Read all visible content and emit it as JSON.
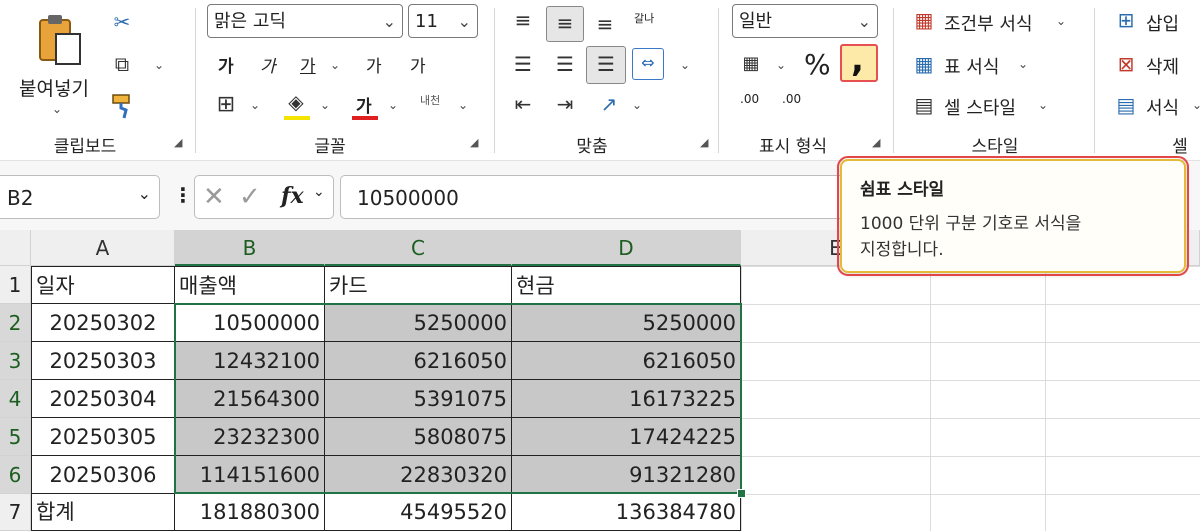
{
  "ribbon": {
    "clipboard": {
      "paste_label": "붙여넣기",
      "group_label": "클립보드"
    },
    "font": {
      "font_name": "맑은 고딕",
      "font_size": "11",
      "group_label": "글꼴",
      "bold": "가",
      "italic": "가",
      "underline": "가",
      "grow_font": "가",
      "shrink_font": "가",
      "font_color_glyph": "가",
      "phonetic_label": "내천"
    },
    "alignment": {
      "group_label": "맞춤",
      "wrap_glyph": "갈나"
    },
    "number": {
      "format": "일반",
      "percent": "%",
      "comma": ",",
      "group_label": "표시 형식",
      "inc_decimal": ".00",
      "dec_decimal": ".00"
    },
    "styles": {
      "conditional": "조건부 서식",
      "table": "표 서식",
      "cell_styles": "셀 스타일",
      "group_label": "스타일"
    },
    "cells": {
      "insert": "삽입",
      "delete": "삭제",
      "format": "서식",
      "group_label": "셀"
    }
  },
  "formula_bar": {
    "name_box": "B2",
    "fx": "fx",
    "value": "10500000"
  },
  "tooltip": {
    "title": "쉼표 스타일",
    "line1": "1000 단위 구분 기호로 서식을",
    "line2": "지정합니다."
  },
  "columns": [
    "A",
    "B",
    "C",
    "D",
    "E"
  ],
  "rows": [
    {
      "num": "1",
      "a": "일자",
      "b": "매출액",
      "c": "카드",
      "d": "현금"
    },
    {
      "num": "2",
      "a": "20250302",
      "b": "10500000",
      "c": "5250000",
      "d": "5250000"
    },
    {
      "num": "3",
      "a": "20250303",
      "b": "12432100",
      "c": "6216050",
      "d": "6216050"
    },
    {
      "num": "4",
      "a": "20250304",
      "b": "21564300",
      "c": "5391075",
      "d": "16173225"
    },
    {
      "num": "5",
      "a": "20250305",
      "b": "23232300",
      "c": "5808075",
      "d": "17424225"
    },
    {
      "num": "6",
      "a": "20250306",
      "b": "114151600",
      "c": "22830320",
      "d": "91321280"
    },
    {
      "num": "7",
      "a": "합계",
      "b": "181880300",
      "c": "45495520",
      "d": "136384780"
    }
  ],
  "colors": {
    "accent_green": "#217346",
    "tooltip_border": "#e5b93a",
    "highlight": "#e34646",
    "selection_gray": "#c8c8c8"
  }
}
